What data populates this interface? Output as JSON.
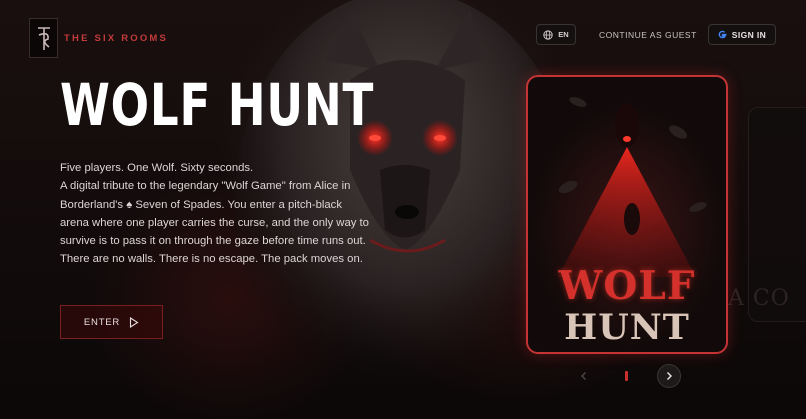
{
  "brand": {
    "name": "THE SIX ROOMS"
  },
  "header": {
    "lang_label": "EN",
    "guest_label": "CONTINUE AS GUEST",
    "signin_label": "SIGN IN"
  },
  "hero": {
    "title": "WOLF HUNT",
    "line1": "Five players. One Wolf. Sixty seconds.",
    "line2": "A digital tribute to the legendary \"Wolf Game\" from Alice in Borderland's ♠ Seven of Spades. You enter a pitch-black arena where one player carries the curse, and the only way to survive is to pass it on through the gaze before time runs out. There are no walls. There is no escape. The pack moves on.",
    "enter_label": "ENTER"
  },
  "card": {
    "title_line1": "WOLF",
    "title_line2": "HUNT"
  },
  "next_card": {
    "partial_text": "A CO"
  },
  "colors": {
    "accent": "#c23a3a",
    "card_border": "#c43434",
    "background": "#0d0909"
  },
  "icons": [
    "logo-emblem",
    "globe-icon",
    "google-icon",
    "play-icon",
    "chevron-left-icon",
    "chevron-right-icon"
  ]
}
